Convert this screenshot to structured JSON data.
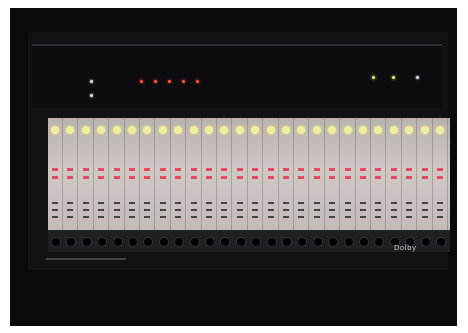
{
  "image": {
    "description_icon": "photo-icon"
  },
  "rack": {
    "logo_text": "Dolby"
  },
  "colors": {
    "led_red": "#ff5a3a",
    "led_yellow": "#eaf07a",
    "knob": "#f2eea0",
    "button_pink": "#e64a66"
  }
}
